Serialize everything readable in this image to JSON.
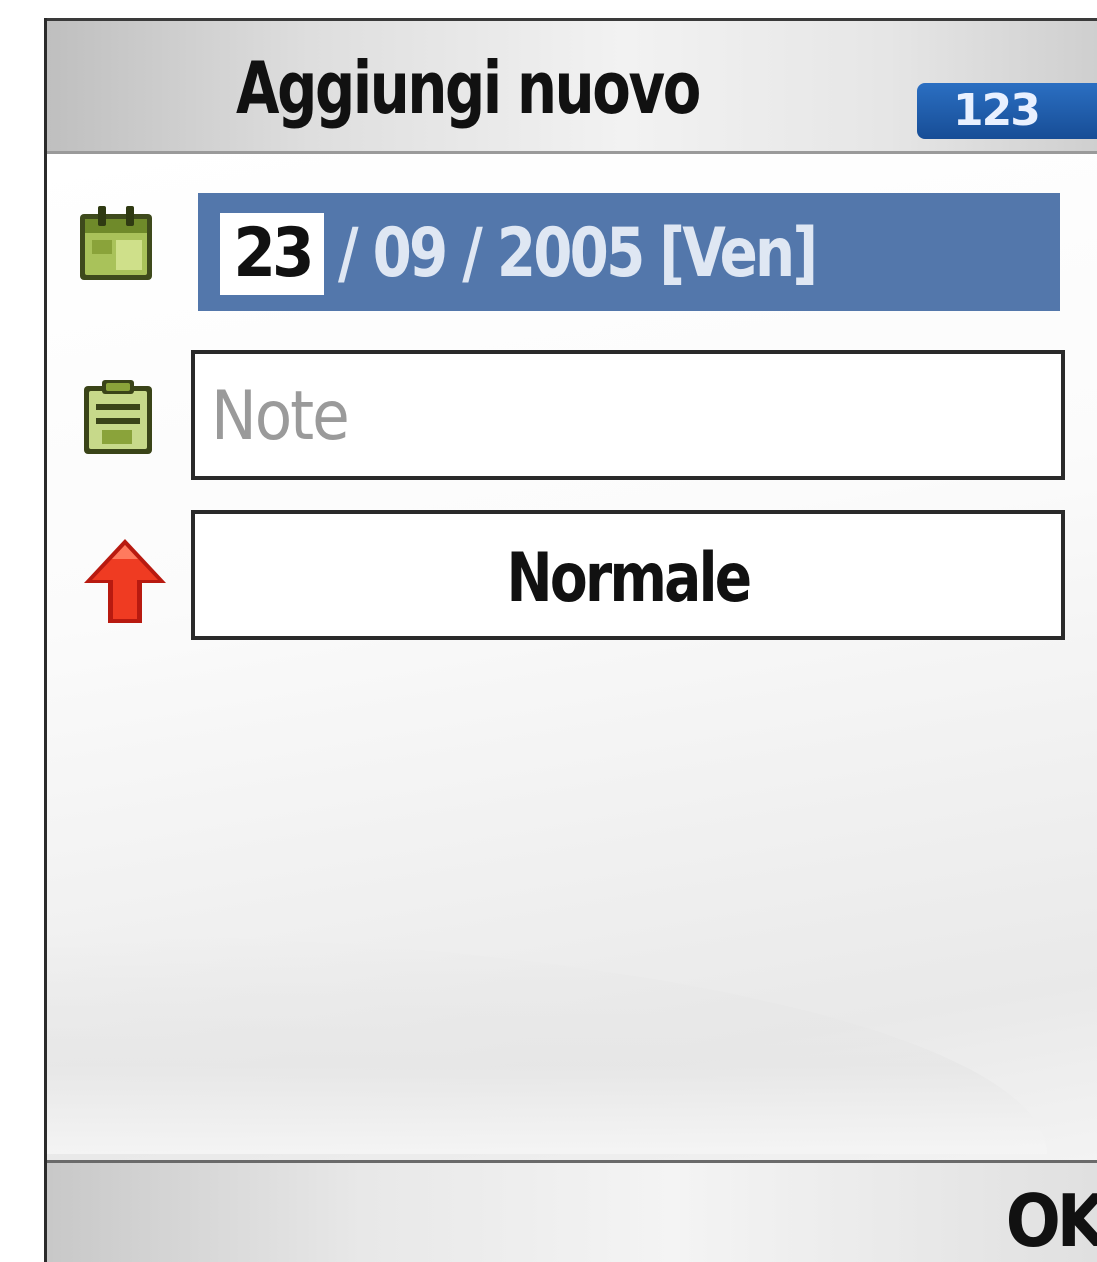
{
  "header": {
    "title": "Aggiungi nuovo",
    "input_mode": "123"
  },
  "form": {
    "date": {
      "day": "23",
      "rest": "/ 09 / 2005 [Ven]",
      "icon": "calendar-icon"
    },
    "note": {
      "placeholder": "Note",
      "value": "",
      "icon": "memo-icon"
    },
    "priority": {
      "value": "Normale",
      "icon": "priority-arrow-icon"
    }
  },
  "softkeys": {
    "right": "OK"
  },
  "colors": {
    "selection": "#5377ab",
    "badge": "#1f5ca8",
    "priority_arrow": "#e02a1a",
    "icon_green": "#8aa33a"
  }
}
